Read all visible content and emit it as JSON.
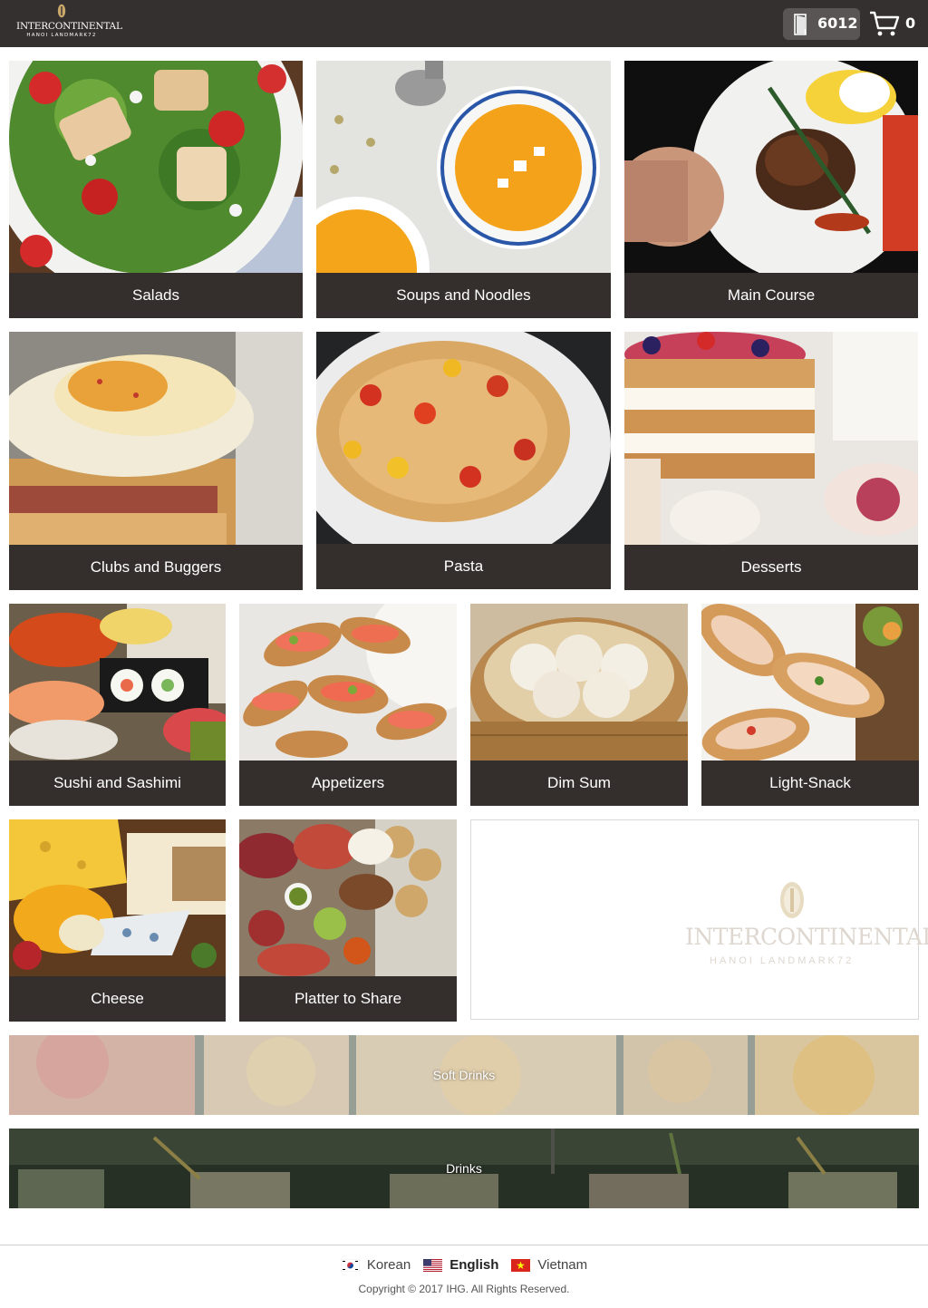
{
  "header": {
    "brand": "INTERCONTINENTAL",
    "sub": "HANOI LANDMARK72",
    "room_number": "6012",
    "cart_count": "0"
  },
  "categories": [
    {
      "label": "Salads"
    },
    {
      "label": "Soups and Noodles"
    },
    {
      "label": "Main Course"
    },
    {
      "label": "Clubs and Buggers"
    },
    {
      "label": "Pasta"
    },
    {
      "label": "Desserts"
    },
    {
      "label": "Sushi and Sashimi"
    },
    {
      "label": "Appetizers"
    },
    {
      "label": "Dim Sum"
    },
    {
      "label": "Light-Snack"
    },
    {
      "label": "Cheese"
    },
    {
      "label": "Platter to Share"
    }
  ],
  "logo_tile": {
    "brand": "INTERCONTINENTAL.",
    "sub": "HANOI LANDMARK72"
  },
  "banners": {
    "soft_drinks": "Soft Drinks",
    "drinks": "Drinks"
  },
  "footer": {
    "languages": [
      "Korean",
      "English",
      "Vietnam"
    ],
    "active_language": "English",
    "copyright": "Copyright © 2017 IHG. All Rights Reserved."
  },
  "colors": {
    "header_bg": "#343030",
    "caption_bg": "#342e2c",
    "badge_bg": "#5a5555"
  }
}
